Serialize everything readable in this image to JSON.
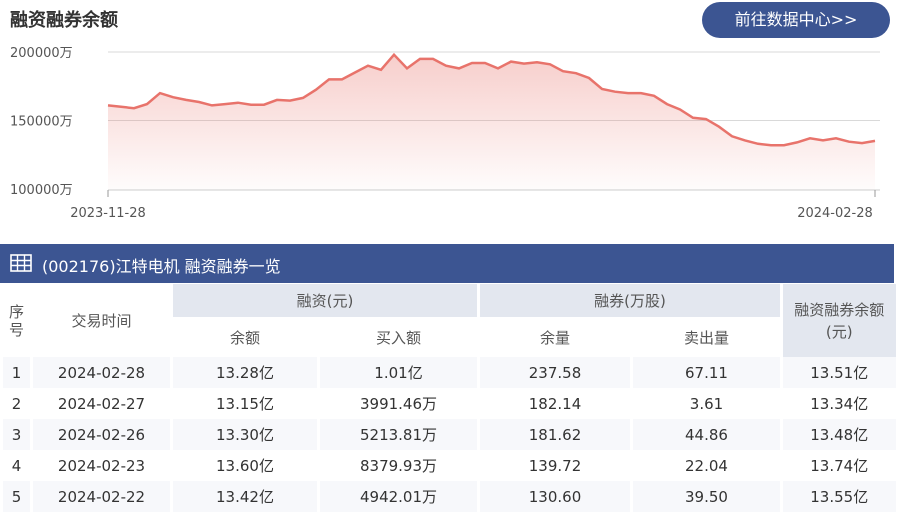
{
  "header": {
    "title": "融资融券余额",
    "datacenter_label": "前往数据中心>>"
  },
  "chart_data": {
    "type": "area",
    "y_unit": "万",
    "yticks": [
      200000,
      150000,
      100000
    ],
    "ytick_labels": [
      "200000万",
      "150000万",
      "100000万"
    ],
    "ylim": [
      100000,
      210000
    ],
    "x_start_label": "2023-11-28",
    "x_end_label": "2024-02-28",
    "line_color": "#e8736b",
    "values": [
      161000,
      160000,
      159000,
      162000,
      170000,
      167000,
      165000,
      163500,
      161000,
      162000,
      163000,
      161500,
      161500,
      165000,
      164500,
      166500,
      172500,
      180000,
      180000,
      185000,
      190000,
      187000,
      198000,
      188000,
      195000,
      195000,
      190000,
      188000,
      192000,
      192000,
      188000,
      193000,
      191500,
      192500,
      191000,
      186000,
      184500,
      181000,
      173000,
      171000,
      170000,
      170000,
      168000,
      162000,
      158000,
      152000,
      151000,
      145500,
      138500,
      135500,
      133000,
      132000,
      132000,
      134000,
      137000,
      135500,
      137000,
      134500,
      133500,
      135100
    ]
  },
  "table": {
    "title": "(002176)江特电机 融资融券一览",
    "col_index": "序号",
    "col_date": "交易时间",
    "group_margin": "融资(元)",
    "group_short": "融券(万股)",
    "col_total": "融资融券余额(元)",
    "sub_margin_balance": "余额",
    "sub_margin_buy": "买入额",
    "sub_short_balance": "余量",
    "sub_short_sell": "卖出量",
    "rows": [
      {
        "index": "1",
        "date": "2024-02-28",
        "margin_balance": "13.28亿",
        "margin_buy": "1.01亿",
        "short_balance": "237.58",
        "short_sell": "67.11",
        "total": "13.51亿"
      },
      {
        "index": "2",
        "date": "2024-02-27",
        "margin_balance": "13.15亿",
        "margin_buy": "3991.46万",
        "short_balance": "182.14",
        "short_sell": "3.61",
        "total": "13.34亿"
      },
      {
        "index": "3",
        "date": "2024-02-26",
        "margin_balance": "13.30亿",
        "margin_buy": "5213.81万",
        "short_balance": "181.62",
        "short_sell": "44.86",
        "total": "13.48亿"
      },
      {
        "index": "4",
        "date": "2024-02-23",
        "margin_balance": "13.60亿",
        "margin_buy": "8379.93万",
        "short_balance": "139.72",
        "short_sell": "22.04",
        "total": "13.74亿"
      },
      {
        "index": "5",
        "date": "2024-02-22",
        "margin_balance": "13.42亿",
        "margin_buy": "4942.01万",
        "short_balance": "130.60",
        "short_sell": "39.50",
        "total": "13.55亿"
      }
    ]
  }
}
